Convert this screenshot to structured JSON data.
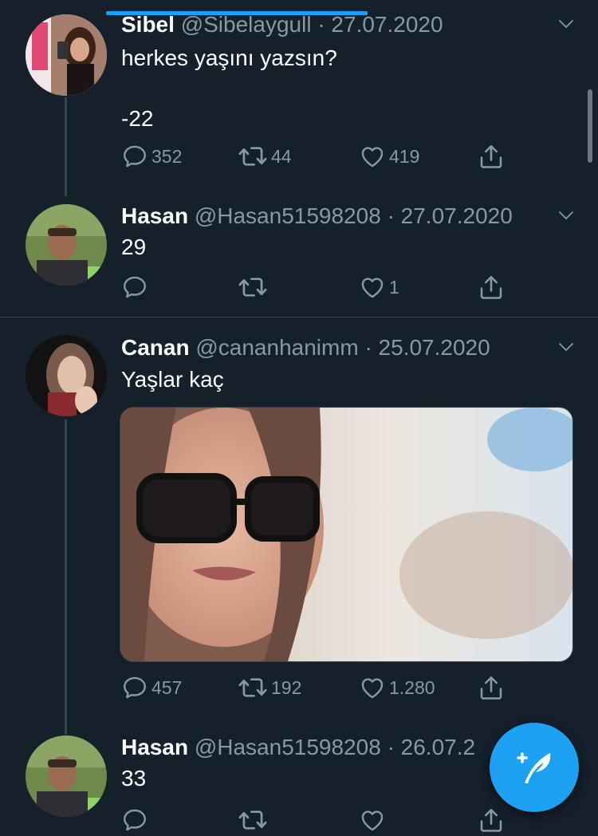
{
  "tweets": [
    {
      "name": "Sibel",
      "handle": "@Sibelaygull",
      "date": "· 27.07.2020",
      "text": "herkes yaşını yazsın?\n\n-22",
      "replies": "352",
      "retweets": "44",
      "likes": "419"
    },
    {
      "name": "Hasan",
      "handle": "@Hasan51598208",
      "date": "· 27.07.2020",
      "text": "29",
      "replies": "",
      "retweets": "",
      "likes": "1"
    },
    {
      "name": "Canan",
      "handle": "@cananhanimm",
      "date": "· 25.07.2020",
      "text": "Yaşlar kaç",
      "replies": "457",
      "retweets": "192",
      "likes": "1.280"
    },
    {
      "name": "Hasan",
      "handle": "@Hasan51598208",
      "date": "· 26.07.2",
      "text": "33",
      "replies": "",
      "retweets": "",
      "likes": ""
    }
  ],
  "icons": {
    "reply": "reply-icon",
    "retweet": "retweet-icon",
    "like": "heart-icon",
    "share": "share-icon",
    "more": "chevron-down-icon",
    "compose": "compose-tweet-icon"
  },
  "colors": {
    "background": "#15202b",
    "accent": "#1da1f2",
    "secondary_text": "#8899a6",
    "divider": "#38444d"
  }
}
